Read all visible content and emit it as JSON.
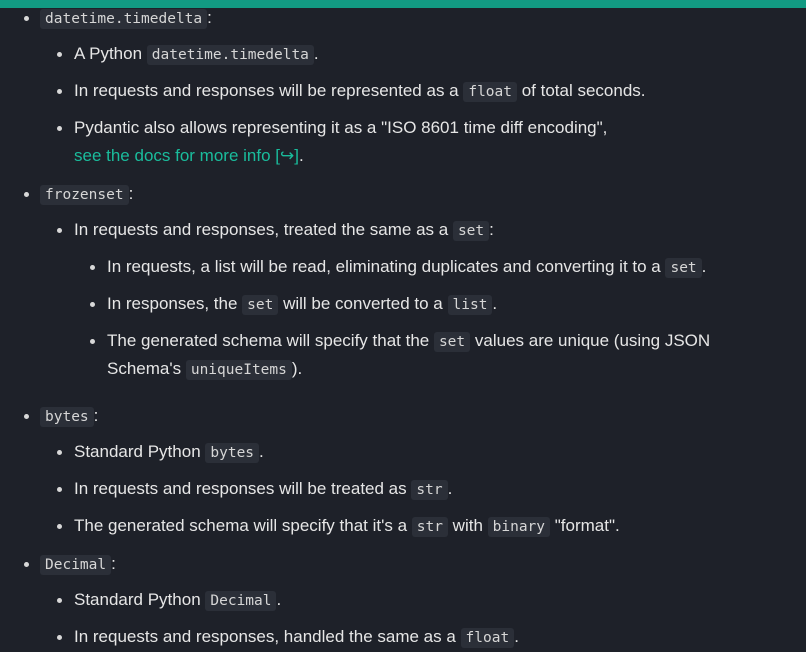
{
  "colors": {
    "accent_bar": "#129b83",
    "background": "#1e2129",
    "link": "#1abc9c",
    "code_bg": "#2b2f38"
  },
  "doc": {
    "timedelta": {
      "code": "datetime.timedelta",
      "suffix": ":",
      "sub1_pre": "A Python ",
      "sub1_code": "datetime.timedelta",
      "sub1_post": ".",
      "sub2_pre": "In requests and responses will be represented as a ",
      "sub2_code": "float",
      "sub2_post": " of total seconds.",
      "sub3_line1": "Pydantic also allows representing it as a \"ISO 8601 time diff encoding\",",
      "sub3_link": "see the docs for more info [↪]",
      "sub3_post": "."
    },
    "frozenset": {
      "code": "frozenset",
      "suffix": ":",
      "sub1_pre": "In requests and responses, treated the same as a ",
      "sub1_code": "set",
      "sub1_post": ":",
      "n1_pre": "In requests, a list will be read, eliminating duplicates and converting it to a ",
      "n1_code": "set",
      "n1_post": ".",
      "n2_pre": "In responses, the ",
      "n2_code": "set",
      "n2_mid": " will be converted to a ",
      "n2_code2": "list",
      "n2_post": ".",
      "n3_pre": "The generated schema will specify that the ",
      "n3_code": "set",
      "n3_post": " values are unique (using JSON",
      "n3_line2_pre": "Schema's ",
      "n3_line2_code": "uniqueItems",
      "n3_line2_post": ")."
    },
    "bytes": {
      "code": "bytes",
      "suffix": ":",
      "sub1_pre": "Standard Python ",
      "sub1_code": "bytes",
      "sub1_post": ".",
      "sub2_pre": "In requests and responses will be treated as ",
      "sub2_code": "str",
      "sub2_post": ".",
      "sub3_pre": "The generated schema will specify that it's a ",
      "sub3_code": "str",
      "sub3_mid": " with ",
      "sub3_code2": "binary",
      "sub3_post": " \"format\"."
    },
    "decimal": {
      "code": "Decimal",
      "suffix": ":",
      "sub1_pre": "Standard Python ",
      "sub1_code": "Decimal",
      "sub1_post": ".",
      "sub2_pre": "In requests and responses, handled the same as a ",
      "sub2_code": "float",
      "sub2_post": "."
    }
  }
}
